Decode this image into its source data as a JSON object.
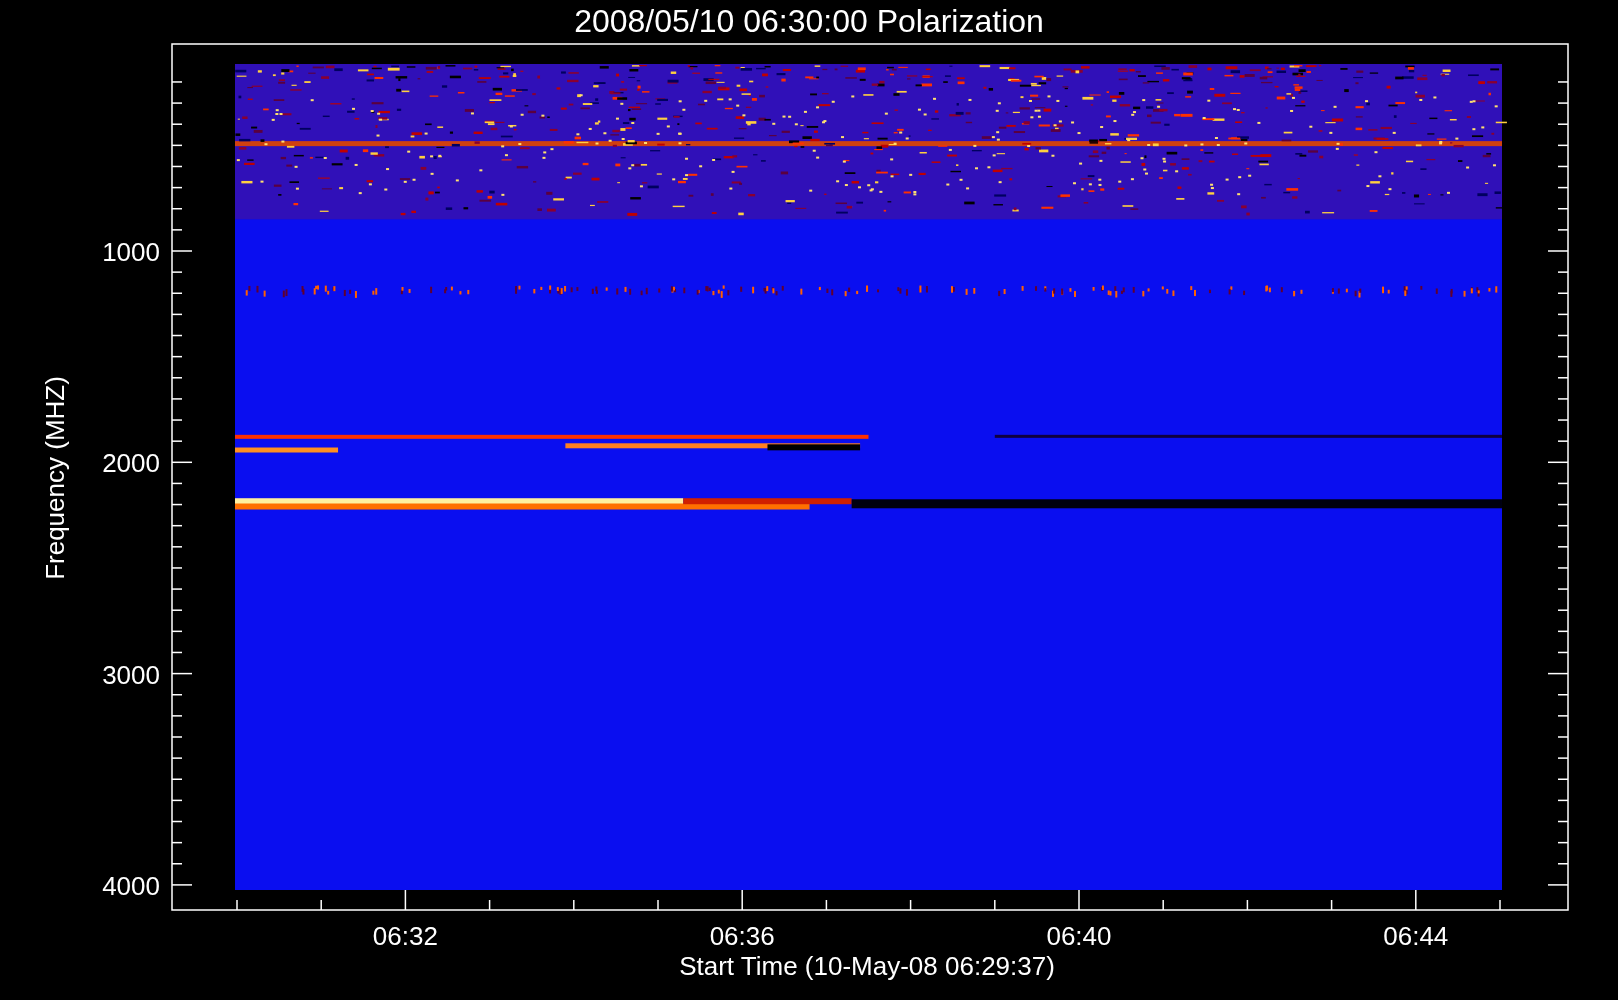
{
  "title": "2008/05/10 06:30:00 Polarization",
  "y_axis": {
    "label": "Frequency (MHZ)",
    "ticks": [
      "1000",
      "2000",
      "3000",
      "4000"
    ]
  },
  "x_axis": {
    "label": "Start Time (10-May-08 06:29:37)",
    "ticks": [
      "06:32",
      "06:36",
      "06:40",
      "06:44"
    ]
  }
}
